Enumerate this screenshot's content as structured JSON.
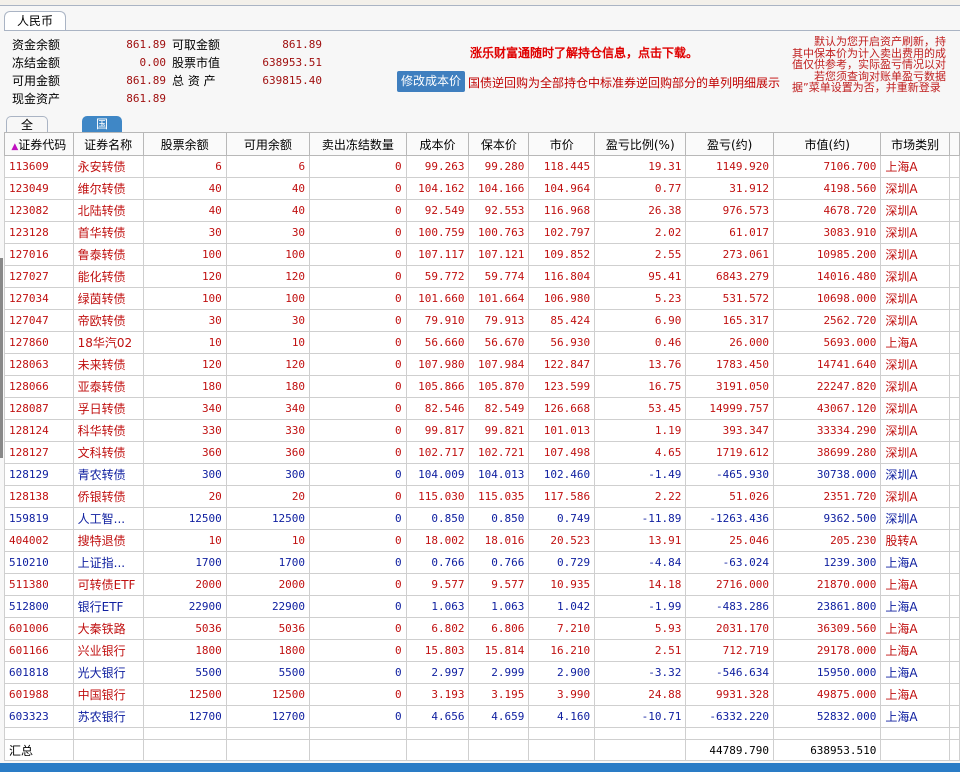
{
  "currency_tab": "人民币",
  "summary": [
    {
      "label": "资金余额",
      "value": "861.89",
      "label2": "可取金额",
      "value2": "861.89"
    },
    {
      "label": "冻结金额",
      "value": "0.00",
      "label2": "股票市值",
      "value2": "638953.51"
    },
    {
      "label": "可用金额",
      "value": "861.89",
      "label2": "总 资 产",
      "value2": "639815.40"
    },
    {
      "label": "现金资产",
      "value": "861.89"
    }
  ],
  "promo": "涨乐财富通随时了解持仓信息，点击下载。",
  "edit_cost_button": "修改成本价",
  "hint": "国债逆回购为全部持仓中标准券逆回购部分的单列明细展示",
  "notice_lines": [
    "　　默认为您开启资产刷新，持",
    "其中保本价为计入卖出费用的成",
    "值仅供参考，实际盈亏情况以对",
    "　　若您须查询对账单盈亏数据",
    "据”菜单设置为否，并重新登录"
  ],
  "tabs": [
    "全部持仓",
    "国债逆回购"
  ],
  "columns": [
    "证券代码",
    "证券名称",
    "股票余额",
    "可用余额",
    "卖出冻结数量",
    "成本价",
    "保本价",
    "市价",
    "盈亏比例(%)",
    "盈亏(约)",
    "市值(约)",
    "市场类别"
  ],
  "rows": [
    [
      "113609",
      "永安转债",
      "6",
      "6",
      "0",
      "99.263",
      "99.280",
      "118.445",
      "19.31",
      "1149.920",
      "7106.700",
      "上海A"
    ],
    [
      "123049",
      "维尔转债",
      "40",
      "40",
      "0",
      "104.162",
      "104.166",
      "104.964",
      "0.77",
      "31.912",
      "4198.560",
      "深圳A"
    ],
    [
      "123082",
      "北陆转债",
      "40",
      "40",
      "0",
      "92.549",
      "92.553",
      "116.968",
      "26.38",
      "976.573",
      "4678.720",
      "深圳A"
    ],
    [
      "123128",
      "首华转债",
      "30",
      "30",
      "0",
      "100.759",
      "100.763",
      "102.797",
      "2.02",
      "61.017",
      "3083.910",
      "深圳A"
    ],
    [
      "127016",
      "鲁泰转债",
      "100",
      "100",
      "0",
      "107.117",
      "107.121",
      "109.852",
      "2.55",
      "273.061",
      "10985.200",
      "深圳A"
    ],
    [
      "127027",
      "能化转债",
      "120",
      "120",
      "0",
      "59.772",
      "59.774",
      "116.804",
      "95.41",
      "6843.279",
      "14016.480",
      "深圳A"
    ],
    [
      "127034",
      "绿茵转债",
      "100",
      "100",
      "0",
      "101.660",
      "101.664",
      "106.980",
      "5.23",
      "531.572",
      "10698.000",
      "深圳A"
    ],
    [
      "127047",
      "帝欧转债",
      "30",
      "30",
      "0",
      "79.910",
      "79.913",
      "85.424",
      "6.90",
      "165.317",
      "2562.720",
      "深圳A"
    ],
    [
      "127860",
      "18华汽02",
      "10",
      "10",
      "0",
      "56.660",
      "56.670",
      "56.930",
      "0.46",
      "26.000",
      "5693.000",
      "上海A"
    ],
    [
      "128063",
      "未来转债",
      "120",
      "120",
      "0",
      "107.980",
      "107.984",
      "122.847",
      "13.76",
      "1783.450",
      "14741.640",
      "深圳A"
    ],
    [
      "128066",
      "亚泰转债",
      "180",
      "180",
      "0",
      "105.866",
      "105.870",
      "123.599",
      "16.75",
      "3191.050",
      "22247.820",
      "深圳A"
    ],
    [
      "128087",
      "孚日转债",
      "340",
      "340",
      "0",
      "82.546",
      "82.549",
      "126.668",
      "53.45",
      "14999.757",
      "43067.120",
      "深圳A"
    ],
    [
      "128124",
      "科华转债",
      "330",
      "330",
      "0",
      "99.817",
      "99.821",
      "101.013",
      "1.19",
      "393.347",
      "33334.290",
      "深圳A"
    ],
    [
      "128127",
      "文科转债",
      "360",
      "360",
      "0",
      "102.717",
      "102.721",
      "107.498",
      "4.65",
      "1719.612",
      "38699.280",
      "深圳A"
    ],
    [
      "128129",
      "青农转债",
      "300",
      "300",
      "0",
      "104.009",
      "104.013",
      "102.460",
      "-1.49",
      "-465.930",
      "30738.000",
      "深圳A"
    ],
    [
      "128138",
      "侨银转债",
      "20",
      "20",
      "0",
      "115.030",
      "115.035",
      "117.586",
      "2.22",
      "51.026",
      "2351.720",
      "深圳A"
    ],
    [
      "159819",
      "人工智...",
      "12500",
      "12500",
      "0",
      "0.850",
      "0.850",
      "0.749",
      "-11.89",
      "-1263.436",
      "9362.500",
      "深圳A"
    ],
    [
      "404002",
      "搜特退债",
      "10",
      "10",
      "0",
      "18.002",
      "18.016",
      "20.523",
      "13.91",
      "25.046",
      "205.230",
      "股转A"
    ],
    [
      "510210",
      "上证指...",
      "1700",
      "1700",
      "0",
      "0.766",
      "0.766",
      "0.729",
      "-4.84",
      "-63.024",
      "1239.300",
      "上海A"
    ],
    [
      "511380",
      "可转债ETF",
      "2000",
      "2000",
      "0",
      "9.577",
      "9.577",
      "10.935",
      "14.18",
      "2716.000",
      "21870.000",
      "上海A"
    ],
    [
      "512800",
      "银行ETF",
      "22900",
      "22900",
      "0",
      "1.063",
      "1.063",
      "1.042",
      "-1.99",
      "-483.286",
      "23861.800",
      "上海A"
    ],
    [
      "601006",
      "大秦铁路",
      "5036",
      "5036",
      "0",
      "6.802",
      "6.806",
      "7.210",
      "5.93",
      "2031.170",
      "36309.560",
      "上海A"
    ],
    [
      "601166",
      "兴业银行",
      "1800",
      "1800",
      "0",
      "15.803",
      "15.814",
      "16.210",
      "2.51",
      "712.719",
      "29178.000",
      "上海A"
    ],
    [
      "601818",
      "光大银行",
      "5500",
      "5500",
      "0",
      "2.997",
      "2.999",
      "2.900",
      "-3.32",
      "-546.634",
      "15950.000",
      "上海A"
    ],
    [
      "601988",
      "中国银行",
      "12500",
      "12500",
      "0",
      "3.193",
      "3.195",
      "3.990",
      "24.88",
      "9931.328",
      "49875.000",
      "上海A"
    ],
    [
      "603323",
      "苏农银行",
      "12700",
      "12700",
      "0",
      "4.656",
      "4.659",
      "4.160",
      "-10.71",
      "-6332.220",
      "52832.000",
      "上海A"
    ]
  ],
  "total": {
    "label": "汇总",
    "profit": "44789.790",
    "market_value": "638953.510"
  },
  "colors": {
    "gain": "#c01010",
    "loss": "#1020a0",
    "accent": "#3f87c6"
  }
}
